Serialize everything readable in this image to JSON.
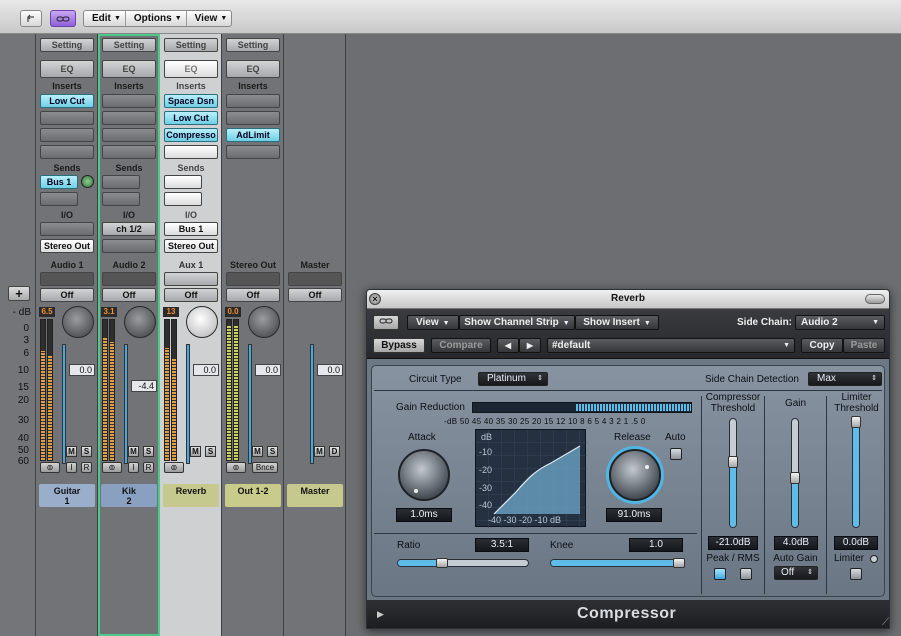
{
  "toolbar": {
    "menus": [
      "Edit",
      "Options",
      "View"
    ]
  },
  "ruler": {
    "ticks": [
      "dB",
      "0",
      "3",
      "6",
      "10",
      "15",
      "20",
      "30",
      "40",
      "50",
      "60"
    ],
    "dash": "-",
    "add_label": "+"
  },
  "strips": [
    {
      "setting": "Setting",
      "eq": "EQ",
      "inserts_label": "Inserts",
      "insert1": "Low Cut",
      "insert2": "",
      "insert3": "",
      "sends_label": "Sends",
      "send1": "Bus 1",
      "io_label": "I/O",
      "input": "",
      "output": "Stereo Out",
      "name": "Audio 1",
      "automation": "Off",
      "peak": "6.5",
      "fader": "0.0",
      "m": "M",
      "s": "S",
      "i": "I",
      "r": "R",
      "tag": "Guitar\n1",
      "tag_color": "#9aaecc"
    },
    {
      "setting": "Setting",
      "eq": "EQ",
      "inserts_label": "Inserts",
      "insert1": "",
      "insert2": "",
      "insert3": "",
      "sends_label": "Sends",
      "send1": "",
      "io_label": "I/O",
      "input": "ch 1/2",
      "output": "",
      "name": "Audio 2",
      "automation": "Off",
      "peak": "3.1",
      "fader": "-4.4",
      "m": "M",
      "s": "S",
      "i": "I",
      "r": "R",
      "tag": "Kik\n2",
      "tag_color": "#8aa0c0"
    },
    {
      "setting": "Setting",
      "eq": "EQ",
      "inserts_label": "Inserts",
      "insert1": "Space Dsn",
      "insert2": "Low Cut",
      "insert3": "Compresso",
      "sends_label": "Sends",
      "send1": "",
      "io_label": "I/O",
      "input": "Bus 1",
      "output": "Stereo Out",
      "name": "Aux 1",
      "automation": "Off",
      "peak": "13",
      "fader": "0.0",
      "m": "M",
      "s": "S",
      "tag": "Reverb",
      "tag_color": "#c6c98d"
    },
    {
      "setting": "Setting",
      "eq": "EQ",
      "inserts_label": "Inserts",
      "insert1": "AdLimit",
      "name": "Stereo Out",
      "automation": "Off",
      "peak": "0.0",
      "fader": "0.0",
      "m": "M",
      "s": "S",
      "bnce": "Bnce",
      "tag": "Out 1-2",
      "tag_color": "#c8cb8a"
    },
    {
      "name": "Master",
      "automation": "Off",
      "fader": "0.0",
      "m": "M",
      "d": "D",
      "tag": "Master",
      "tag_color": "#c6c98d"
    }
  ],
  "plugin": {
    "title": "Reverb",
    "view": "View",
    "show_channel_strip": "Show Channel Strip",
    "show_insert": "Show Insert",
    "side_chain_label": "Side Chain:",
    "side_chain_value": "Audio 2",
    "bypass": "Bypass",
    "compare": "Compare",
    "prev": "◀",
    "next": "▶",
    "preset": "#default",
    "copy": "Copy",
    "paste": "Paste",
    "circuit_type_label": "Circuit Type",
    "circuit_type_value": "Platinum",
    "side_chain_detection_label": "Side Chain Detection",
    "side_chain_detection_value": "Max",
    "gain_reduction_label": "Gain Reduction",
    "gr_scale": "-dB  50 45 40 35 30 25 20 15 12 10  8  6  5  4  3  2  1  .5  0",
    "attack_label": "Attack",
    "attack_value": "1.0ms",
    "release_label": "Release",
    "release_value": "91.0ms",
    "auto_label": "Auto",
    "graph_y": [
      "dB",
      "-10",
      "-20",
      "-30",
      "-40"
    ],
    "graph_x": "-40 -30 -20 -10  dB",
    "ratio_label": "Ratio",
    "ratio_value": "3.5:1",
    "ratio_level": 0.34,
    "knee_label": "Knee",
    "knee_value": "1.0",
    "knee_level": 0.97,
    "comp_threshold_label": "Compressor Threshold",
    "comp_threshold_value": "-21.0dB",
    "comp_threshold_level": 0.6,
    "gain_label": "Gain",
    "gain_value": "4.0dB",
    "gain_level": 0.45,
    "limiter_threshold_label": "Limiter Threshold",
    "limiter_threshold_value": "0.0dB",
    "limiter_threshold_level": 0.97,
    "peak_rms_label": "Peak / RMS",
    "auto_gain_label": "Auto Gain",
    "auto_gain_value": "Off",
    "limiter_label": "Limiter",
    "footer_name": "Compressor"
  }
}
